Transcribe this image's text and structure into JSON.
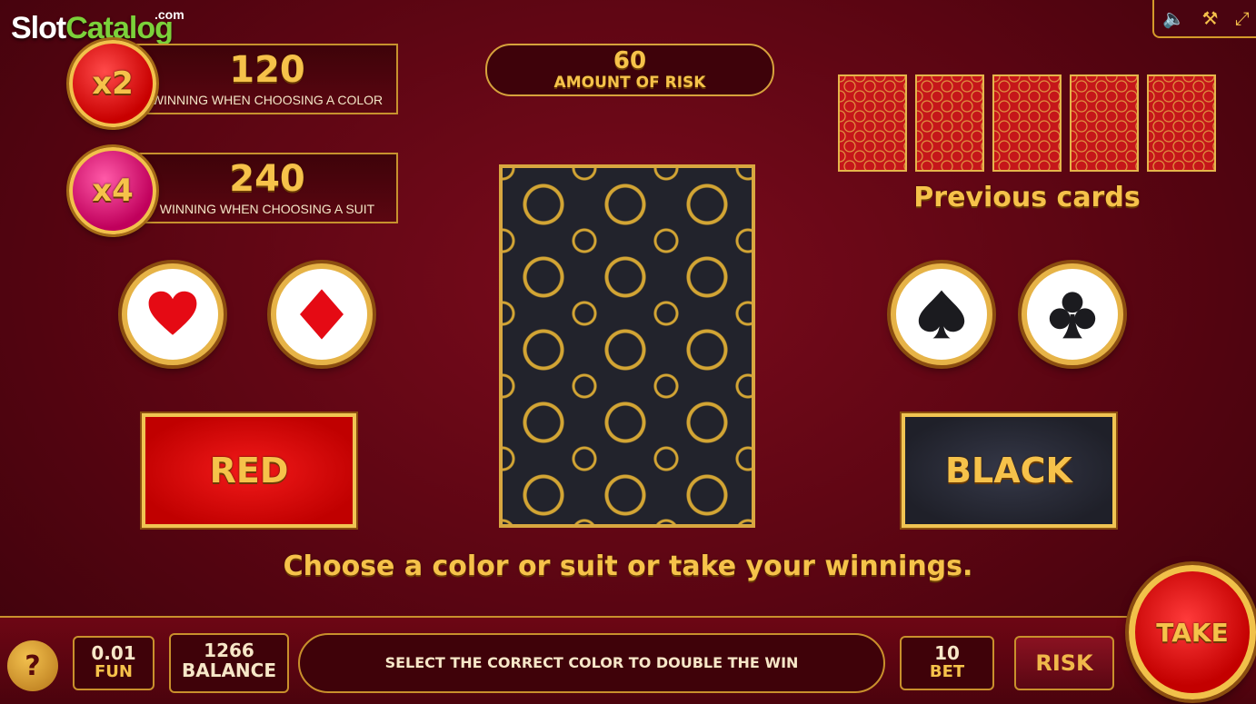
{
  "logo": {
    "part1": "Slot",
    "part2": "Catalog",
    "domain": ".com"
  },
  "top_controls": {
    "sound_icon": "speaker-icon",
    "settings_icon": "tools-icon",
    "fullscreen_icon": "fullscreen-icon"
  },
  "color_win": {
    "multiplier": "x2",
    "value": "120",
    "caption": "WINNING WHEN CHOOSING A COLOR"
  },
  "suit_win": {
    "multiplier": "x4",
    "value": "240",
    "caption": "WINNING WHEN CHOOSING A SUIT"
  },
  "risk": {
    "value": "60",
    "caption": "AMOUNT OF RISK"
  },
  "previous_cards": {
    "label": "Previous cards",
    "count": 5
  },
  "buttons": {
    "red": "RED",
    "black": "BLACK",
    "take": "TAKE",
    "risk": "RISK",
    "help": "?"
  },
  "prompt": "Choose a color or suit or take your winnings.",
  "bottom": {
    "coin_value": "0.01",
    "coin_label": "FUN",
    "balance_value": "1266",
    "balance_label": "BALANCE",
    "message": "SELECT THE CORRECT COLOR TO DOUBLE THE WIN",
    "bet_value": "10",
    "bet_label": "BET"
  },
  "colors": {
    "gold": "#f6c24a",
    "red": "#c80000",
    "dark": "#22232c",
    "background": "#5a0512"
  }
}
